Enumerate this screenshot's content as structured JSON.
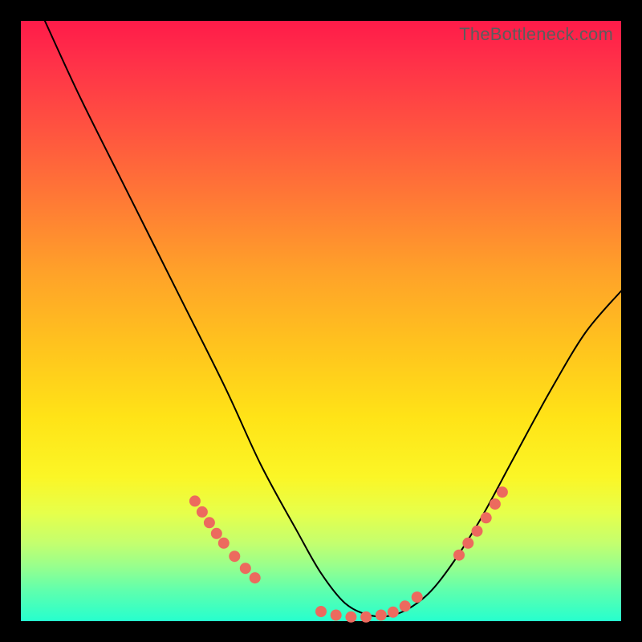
{
  "watermark": "TheBottleneck.com",
  "colors": {
    "gradient_top": "#ff1b49",
    "gradient_bottom": "#26ffce",
    "frame": "#000000",
    "curve": "#000000",
    "dots": "#ec6a5e"
  },
  "chart_data": {
    "type": "line",
    "title": "",
    "xlabel": "",
    "ylabel": "",
    "xlim": [
      0,
      100
    ],
    "ylim": [
      0,
      100
    ],
    "series": [
      {
        "name": "bottleneck-curve",
        "x": [
          4,
          10,
          18,
          26,
          34,
          40,
          46,
          50,
          54,
          58,
          62,
          66,
          70,
          76,
          82,
          88,
          94,
          100
        ],
        "y": [
          100,
          87,
          71,
          55,
          39,
          26,
          15,
          8,
          3,
          1,
          1,
          3,
          7,
          16,
          27,
          38,
          48,
          55
        ]
      }
    ],
    "dot_clusters": [
      {
        "name": "left-cluster",
        "points": [
          {
            "x": 29.0,
            "y": 20.0
          },
          {
            "x": 30.2,
            "y": 18.2
          },
          {
            "x": 31.4,
            "y": 16.4
          },
          {
            "x": 32.6,
            "y": 14.6
          },
          {
            "x": 33.8,
            "y": 13.0
          },
          {
            "x": 35.6,
            "y": 10.8
          },
          {
            "x": 37.4,
            "y": 8.8
          },
          {
            "x": 39.0,
            "y": 7.2
          }
        ]
      },
      {
        "name": "valley-cluster",
        "points": [
          {
            "x": 50.0,
            "y": 1.6
          },
          {
            "x": 52.5,
            "y": 1.0
          },
          {
            "x": 55.0,
            "y": 0.7
          },
          {
            "x": 57.5,
            "y": 0.7
          },
          {
            "x": 60.0,
            "y": 1.0
          },
          {
            "x": 62.0,
            "y": 1.5
          },
          {
            "x": 64.0,
            "y": 2.5
          },
          {
            "x": 66.0,
            "y": 4.0
          }
        ]
      },
      {
        "name": "right-cluster",
        "points": [
          {
            "x": 73.0,
            "y": 11.0
          },
          {
            "x": 74.5,
            "y": 13.0
          },
          {
            "x": 76.0,
            "y": 15.0
          },
          {
            "x": 77.5,
            "y": 17.2
          },
          {
            "x": 79.0,
            "y": 19.5
          },
          {
            "x": 80.2,
            "y": 21.5
          }
        ]
      }
    ]
  }
}
